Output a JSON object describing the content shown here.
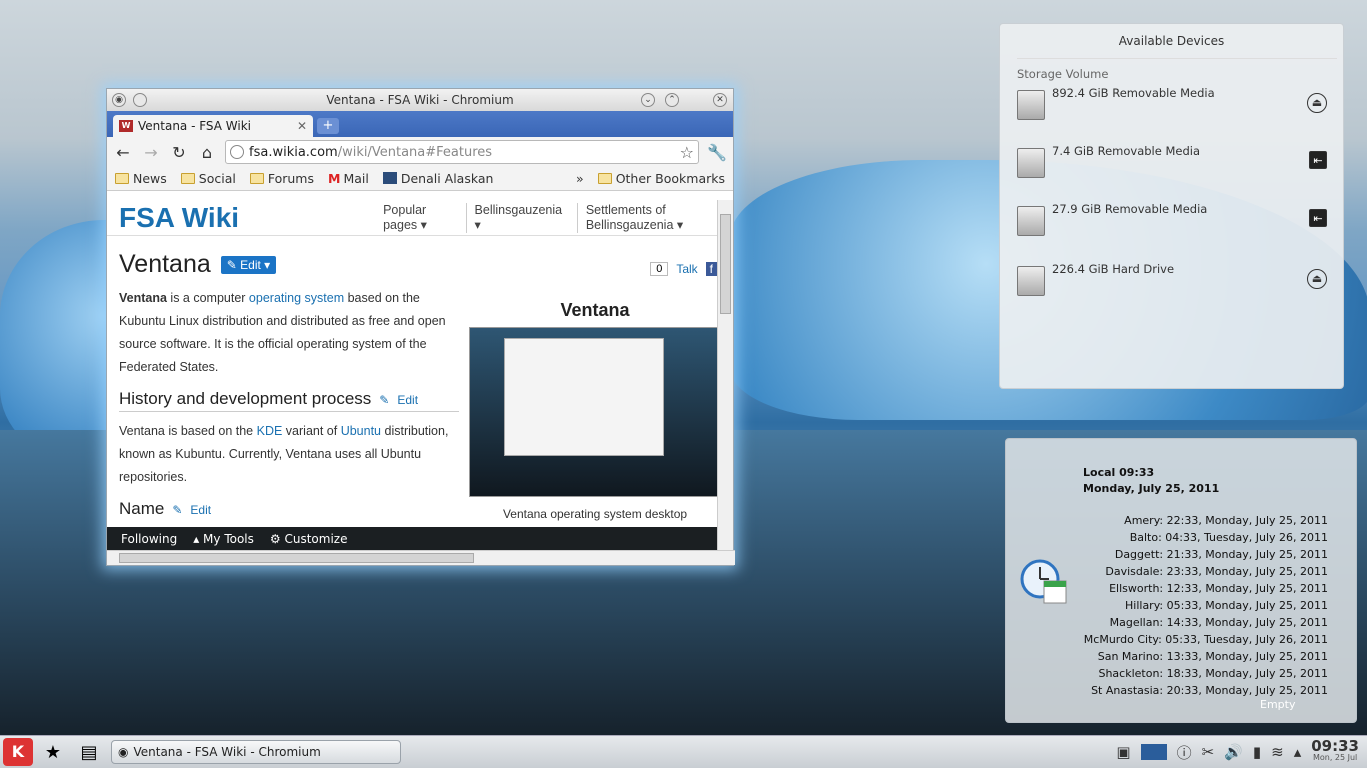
{
  "browser": {
    "title": "Ventana - FSA Wiki - Chromium",
    "tab_label": "Ventana - FSA Wiki",
    "tab_favicon": "W",
    "url_domain": "fsa.wikia.com",
    "url_path": "/wiki/Ventana#Features",
    "bookmarks": [
      "News",
      "Social",
      "Forums",
      "Mail",
      "Denali Alaskan"
    ],
    "other_bookmarks": "Other Bookmarks",
    "bookmarks_overflow": "»"
  },
  "wiki": {
    "logo": "FSA Wiki",
    "nav": [
      "Popular pages ▾",
      "Bellinsgauzenia ▾",
      "Settlements of Bellinsgauzenia ▾"
    ],
    "article_title": "Ventana",
    "edit_label": "Edit",
    "talk_count": "0",
    "talk_label": "Talk",
    "intro_bold": "Ventana",
    "intro_1": " is a computer ",
    "intro_link": "operating system",
    "intro_2": " based on the Kubuntu Linux distribution and distributed as free and open source software. It is the official operating system of the Federated States.",
    "section1_title": "History and development process",
    "section1_edit": "Edit",
    "section1_text_1": "Ventana is based on the ",
    "section1_link_kde": "KDE",
    "section1_text_2": " variant of ",
    "section1_link_ubuntu": "Ubuntu",
    "section1_text_3": " distribution, known as Kubuntu. Currently, Ventana uses all Ubuntu repositories.",
    "section2_title": "Name",
    "section2_edit": "Edit",
    "infobox_title": "Ventana",
    "infobox_caption": "Ventana operating system desktop",
    "toolbar_following": "Following",
    "toolbar_mytools": "My Tools",
    "toolbar_customize": "Customize"
  },
  "devices": {
    "title": "Available Devices",
    "section": "Storage Volume",
    "items": [
      {
        "name": "892.4 GiB Removable Media",
        "action": "eject"
      },
      {
        "name": "7.4 GiB Removable Media",
        "action": "unmount"
      },
      {
        "name": "27.9 GiB Removable Media",
        "action": "unmount"
      },
      {
        "name": "226.4 GiB Hard Drive",
        "action": "eject"
      }
    ]
  },
  "clock": {
    "local_time": "Local 09:33",
    "local_date": "Monday, July 25, 2011",
    "zones": [
      "Amery: 22:33, Monday, July 25, 2011",
      "Balto: 04:33, Tuesday, July 26, 2011",
      "Daggett: 21:33, Monday, July 25, 2011",
      "Davisdale: 23:33, Monday, July 25, 2011",
      "Ellsworth: 12:33, Monday, July 25, 2011",
      "Hillary: 05:33, Monday, July 25, 2011",
      "Magellan: 14:33, Monday, July 25, 2011",
      "McMurdo City: 05:33, Tuesday, July 26, 2011",
      "San Marino: 13:33, Monday, July 25, 2011",
      "Shackleton: 18:33, Monday, July 25, 2011",
      "St Anastasia: 20:33, Monday, July 25, 2011"
    ],
    "empty_label": "Empty"
  },
  "taskbar": {
    "task_label": "Ventana - FSA Wiki - Chromium",
    "time": "09:33",
    "date": "Mon, 25 Jul"
  }
}
